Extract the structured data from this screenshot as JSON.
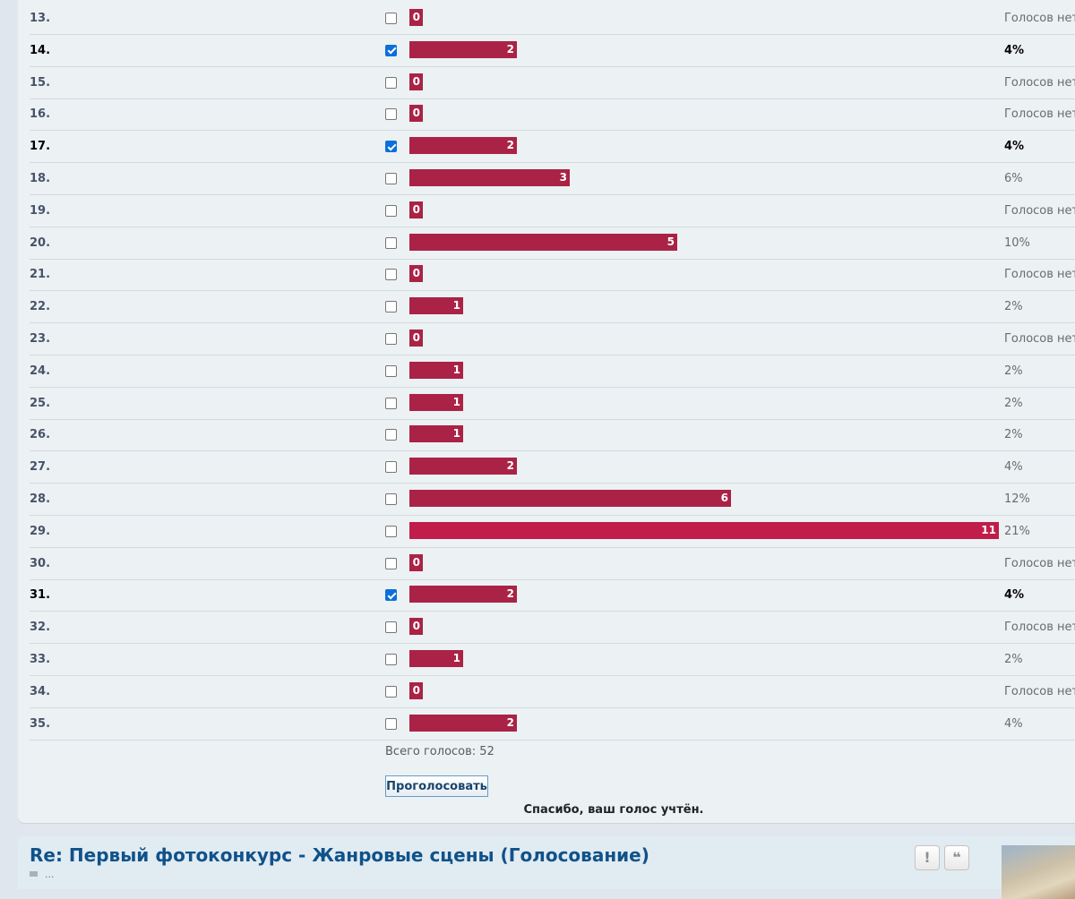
{
  "poll": {
    "options": [
      {
        "number": "13.",
        "votes": 0,
        "percent": "Голосов нет",
        "checked": false
      },
      {
        "number": "14.",
        "votes": 2,
        "percent": "4%",
        "checked": true
      },
      {
        "number": "15.",
        "votes": 0,
        "percent": "Голосов нет",
        "checked": false
      },
      {
        "number": "16.",
        "votes": 0,
        "percent": "Голосов нет",
        "checked": false
      },
      {
        "number": "17.",
        "votes": 2,
        "percent": "4%",
        "checked": true
      },
      {
        "number": "18.",
        "votes": 3,
        "percent": "6%",
        "checked": false
      },
      {
        "number": "19.",
        "votes": 0,
        "percent": "Голосов нет",
        "checked": false
      },
      {
        "number": "20.",
        "votes": 5,
        "percent": "10%",
        "checked": false
      },
      {
        "number": "21.",
        "votes": 0,
        "percent": "Голосов нет",
        "checked": false
      },
      {
        "number": "22.",
        "votes": 1,
        "percent": "2%",
        "checked": false
      },
      {
        "number": "23.",
        "votes": 0,
        "percent": "Голосов нет",
        "checked": false
      },
      {
        "number": "24.",
        "votes": 1,
        "percent": "2%",
        "checked": false
      },
      {
        "number": "25.",
        "votes": 1,
        "percent": "2%",
        "checked": false
      },
      {
        "number": "26.",
        "votes": 1,
        "percent": "2%",
        "checked": false
      },
      {
        "number": "27.",
        "votes": 2,
        "percent": "4%",
        "checked": false
      },
      {
        "number": "28.",
        "votes": 6,
        "percent": "12%",
        "checked": false
      },
      {
        "number": "29.",
        "votes": 11,
        "percent": "21%",
        "checked": false
      },
      {
        "number": "30.",
        "votes": 0,
        "percent": "Голосов нет",
        "checked": false
      },
      {
        "number": "31.",
        "votes": 2,
        "percent": "4%",
        "checked": true
      },
      {
        "number": "32.",
        "votes": 0,
        "percent": "Голосов нет",
        "checked": false
      },
      {
        "number": "33.",
        "votes": 1,
        "percent": "2%",
        "checked": false
      },
      {
        "number": "34.",
        "votes": 0,
        "percent": "Голосов нет",
        "checked": false
      },
      {
        "number": "35.",
        "votes": 2,
        "percent": "4%",
        "checked": false
      }
    ],
    "total_label": "Всего голосов: 52",
    "vote_button_label": "Проголосовать",
    "thanks_message": "Спасибо, ваш голос учтён."
  },
  "post": {
    "title": "Re: Первый фотоконкурс - Жанровые сцены (Голосование)",
    "meta_text": "...",
    "report_icon": "!",
    "quote_icon": "❝"
  },
  "colors": {
    "bar": "#aa2346",
    "bar_max": "#c01d4a",
    "checkbox_checked": "#0b6fdc",
    "title": "#105289"
  }
}
